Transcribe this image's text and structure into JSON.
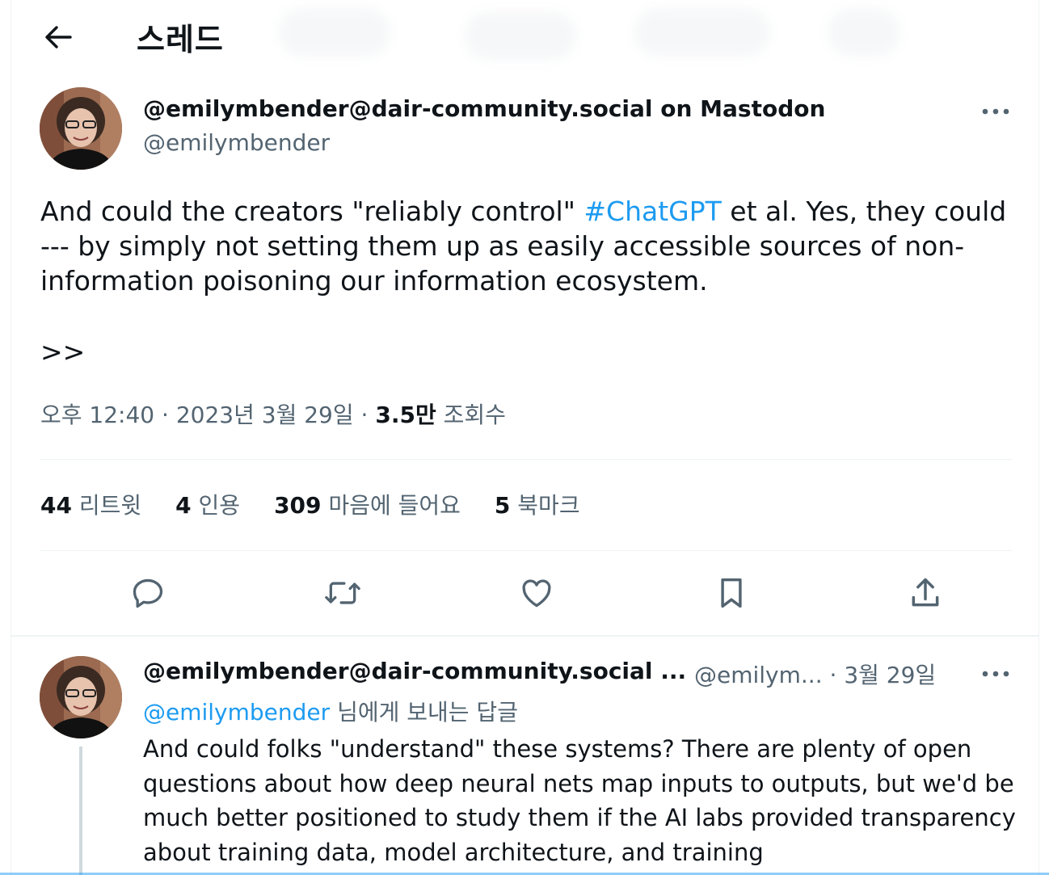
{
  "header": {
    "title": "스레드",
    "back_icon": "arrow-left-icon"
  },
  "tweet": {
    "display_name": "@emilymbender@dair-community.social on Mastodon",
    "handle": "@emilymbender",
    "text_before": "And could the creators \"reliably control\" ",
    "hashtag": "#ChatGPT",
    "text_after": " et al. Yes, they could --- by simply not setting them up as easily accessible sources of non-information poisoning our information ecosystem.",
    "continuation": ">>",
    "time": "오후 12:40",
    "date": "2023년 3월 29일",
    "views_value": "3.5만",
    "views_label": "조회수"
  },
  "stats": [
    {
      "value": "44",
      "label": "리트윗"
    },
    {
      "value": "4",
      "label": "인용"
    },
    {
      "value": "309",
      "label": "마음에 들어요"
    },
    {
      "value": "5",
      "label": "북마크"
    }
  ],
  "actions": [
    "reply-icon",
    "retweet-icon",
    "like-icon",
    "bookmark-icon",
    "share-icon"
  ],
  "reply": {
    "display_name": "@emilymbender@dair-community.social ...",
    "handle": "@emilym...",
    "date": "3월 29일",
    "replying_mention": "@emilymbender",
    "replying_suffix": " 님에게 보내는 답글",
    "text": "And could folks \"understand\" these systems? There are plenty of open questions about how deep neural nets map inputs to outputs, but we'd be much better positioned to study them if the AI labs provided transparency about training data, model architecture, and training"
  },
  "colors": {
    "accent": "#1d9bf0",
    "secondary_text": "#536471",
    "primary_text": "#0f1419",
    "divider": "#eff3f4"
  }
}
